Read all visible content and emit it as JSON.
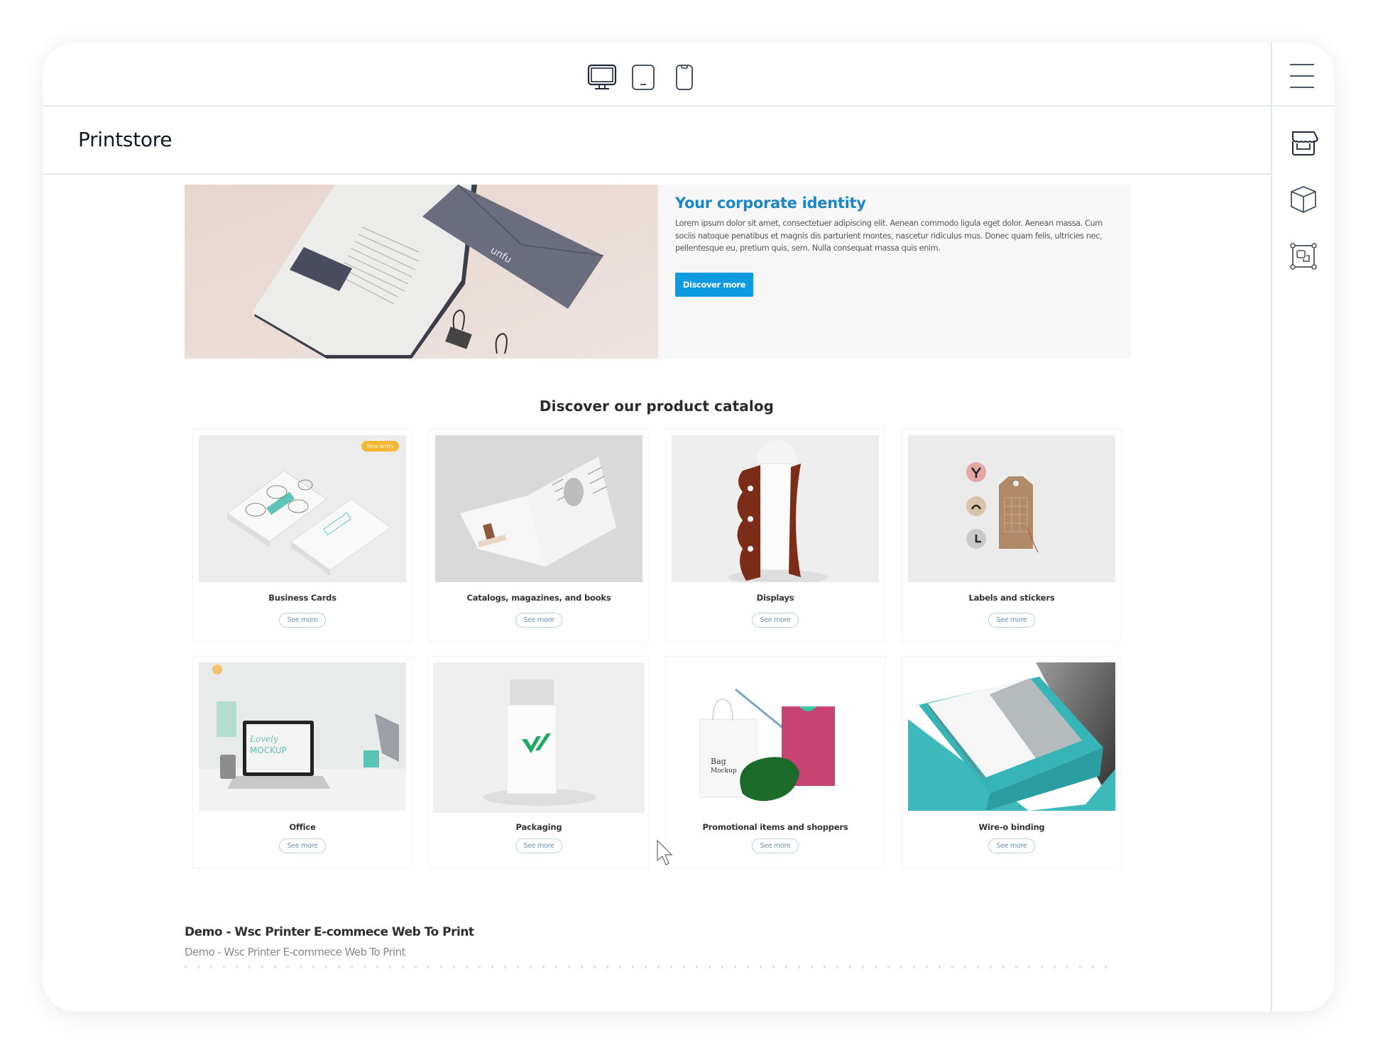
{
  "device_bar": {
    "devices": [
      {
        "name": "desktop",
        "icon": "desktop-icon",
        "active": true
      },
      {
        "name": "tablet",
        "icon": "tablet-icon",
        "active": false
      },
      {
        "name": "mobile",
        "icon": "mobile-icon",
        "active": false
      }
    ]
  },
  "sidebar": {
    "menu_icon": "hamburger-menu-icon",
    "items": [
      {
        "name": "store",
        "icon": "storefront-icon"
      },
      {
        "name": "products",
        "icon": "cube-icon"
      },
      {
        "name": "layout",
        "icon": "selection-frame-icon"
      }
    ]
  },
  "header": {
    "brand": "Printstore"
  },
  "hero": {
    "title": "Your corporate identity",
    "body": "Lorem ipsum dolor sit amet, consectetuer adipiscing elit. Aenean commodo ligula eget dolor. Aenean massa. Cum sociis natoque penatibus et magnis dis parturient montes, nascetur ridiculus mus. Donec quam felis, ultricies nec, pellentesque eu, pretium quis, sem. Nulla consequat massa quis enim.",
    "button_label": "Discover more",
    "image_text": "unfu",
    "accent_color": "#0d9ae0",
    "title_color": "#1b86c6"
  },
  "catalog": {
    "title": "Discover our product catalog",
    "button_label": "See more",
    "products": [
      {
        "name": "Business Cards",
        "badge": "New entry"
      },
      {
        "name": "Catalogs, magazines, and books",
        "badge": null
      },
      {
        "name": "Displays",
        "badge": null
      },
      {
        "name": "Labels and stickers",
        "badge": null
      },
      {
        "name": "Office",
        "badge": null
      },
      {
        "name": "Packaging",
        "badge": null
      },
      {
        "name": "Promotional items and shoppers",
        "badge": null
      },
      {
        "name": "Wire-o binding",
        "badge": null
      }
    ],
    "badge_color": "#f3b733"
  },
  "footer": {
    "title": "Demo - Wsc Printer E-commece Web To Print",
    "subtitle": "Demo - Wsc Printer E-commece Web To Print"
  }
}
